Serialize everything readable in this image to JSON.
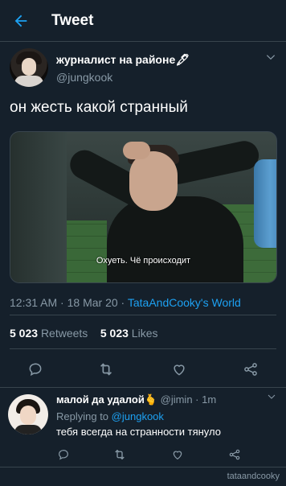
{
  "header": {
    "title": "Tweet"
  },
  "tweet": {
    "author_name": "журналист на районе🖋",
    "author_handle": "@jungkook",
    "text": "он жесть какой странный",
    "media_subtitle": "Охуеть. Чё происходит",
    "time": "12:31 AM",
    "date": "18 Mar 20",
    "source": "TataAndCooky's World",
    "retweets_count": "5 023",
    "retweets_label": "Retweets",
    "likes_count": "5 023",
    "likes_label": "Likes"
  },
  "reply": {
    "author_name": "малой да удалой🫰",
    "author_handle": "@jimin",
    "time": "1m",
    "replying_label": "Replying to",
    "replying_to": "@jungkook",
    "text": "тебя всегда на странности тянуло"
  },
  "watermark": "tataandcooky",
  "colors": {
    "background": "#15202b",
    "accent": "#1da1f2",
    "muted": "#8899a6",
    "border": "#38444d"
  },
  "icons": [
    "back-arrow-icon",
    "chevron-down-icon",
    "reply-icon",
    "retweet-icon",
    "like-icon",
    "share-icon"
  ]
}
